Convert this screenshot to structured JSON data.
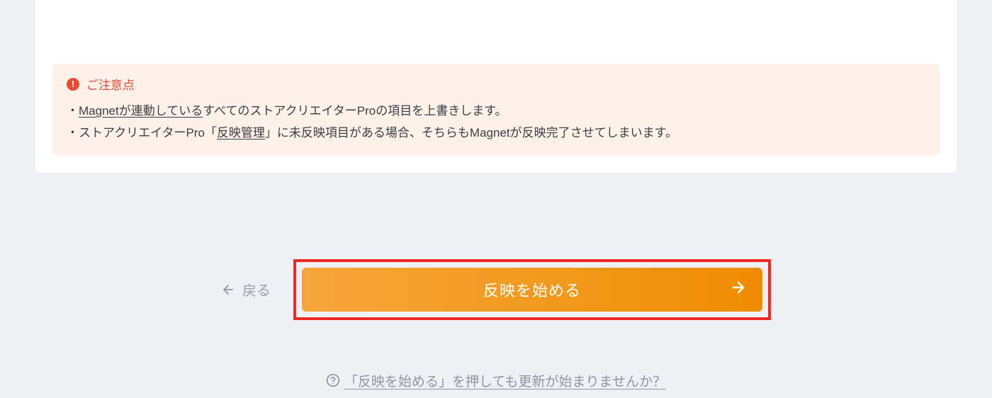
{
  "notice": {
    "title": "ご注意点",
    "line1_prefix": "・",
    "line1_underlined": "Magnetが連動している",
    "line1_suffix": "すべてのストアクリエイターProの項目を上書きします。",
    "line2_prefix": "・ストアクリエイターPro「",
    "line2_underlined": "反映管理",
    "line2_suffix": "」に未反映項目がある場合、そちらもMagnetが反映完了させてしまいます。"
  },
  "actions": {
    "back_label": "戻る",
    "primary_label": "反映を始める"
  },
  "help": {
    "link_text": "「反映を始める」を押しても更新が始まりませんか？"
  }
}
